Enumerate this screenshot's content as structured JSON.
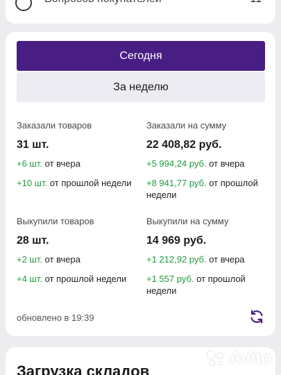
{
  "top_row": {
    "label": "Вопросов покупателей",
    "count": "11"
  },
  "period_tabs": {
    "today": "Сегодня",
    "week": "За неделю"
  },
  "stats": {
    "ordered_items": {
      "title": "Заказали товаров",
      "value": "31 шт.",
      "delta_day_value": "+6 шт.",
      "delta_day_suffix": "от вчера",
      "delta_week_value": "+10 шт.",
      "delta_week_suffix": "от прошлой недели"
    },
    "ordered_sum": {
      "title": "Заказали на сумму",
      "value": "22 408,82 руб.",
      "delta_day_value": "+5 994,24 руб.",
      "delta_day_suffix": "от вчера",
      "delta_week_value": "+8 941,77 руб.",
      "delta_week_suffix": "от прошлой недели"
    },
    "bought_items": {
      "title": "Выкупили товаров",
      "value": "28 шт.",
      "delta_day_value": "+2 шт.",
      "delta_day_suffix": "от вчера",
      "delta_week_value": "+4 шт.",
      "delta_week_suffix": "от прошлой недели"
    },
    "bought_sum": {
      "title": "Выкупили на сумму",
      "value": "14 969 руб.",
      "delta_day_value": "+1 212,92 руб.",
      "delta_day_suffix": "от вчера",
      "delta_week_value": "+1 557 руб.",
      "delta_week_suffix": "от прошлой недели"
    }
  },
  "updated_text": "обновлено в 19:39",
  "next_section_title": "Загрузка складов",
  "watermark": "Avito",
  "colors": {
    "accent": "#481e84",
    "positive": "#1ea03c",
    "background": "#ededf0"
  },
  "icons": {
    "refresh": "refresh-icon",
    "top_row": "circle-icon",
    "watermark": "avito-logo-icon"
  }
}
